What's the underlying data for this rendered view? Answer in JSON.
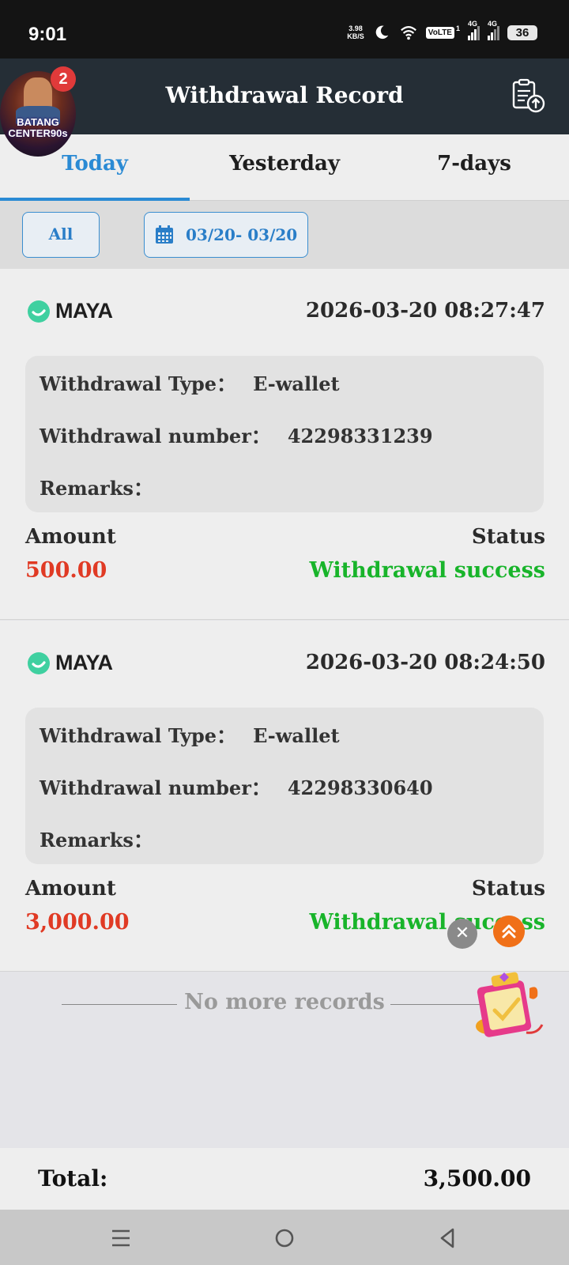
{
  "status_bar": {
    "time": "9:01",
    "net_speed_value": "3.98",
    "net_speed_unit": "KB/S",
    "volte": "VoLTE",
    "sim1_label": "4G",
    "sim2_label": "4G",
    "sim_sub": "1",
    "battery": "36"
  },
  "header": {
    "title": "Withdrawal Record",
    "avatar_text_line1": "BATANG",
    "avatar_text_line2": "CENTER90s",
    "notification_count": "2"
  },
  "tabs": [
    {
      "label": "Today",
      "active": true
    },
    {
      "label": "Yesterday",
      "active": false
    },
    {
      "label": "7-days",
      "active": false
    }
  ],
  "filters": {
    "all_label": "All",
    "date_range": "03/20- 03/20"
  },
  "labels": {
    "withdrawal_type": "Withdrawal Type：",
    "withdrawal_number": "Withdrawal number：",
    "remarks": "Remarks：",
    "amount": "Amount",
    "status": "Status"
  },
  "records": [
    {
      "method": "MAYA",
      "datetime": "2026-03-20 08:27:47",
      "type": "E-wallet",
      "number": "42298331239",
      "remarks": "",
      "amount": "500.00",
      "status": "Withdrawal success"
    },
    {
      "method": "MAYA",
      "datetime": "2026-03-20 08:24:50",
      "type": "E-wallet",
      "number": "42298330640",
      "remarks": "",
      "amount": "3,000.00",
      "status": "Withdrawal success"
    }
  ],
  "footer_note": "No more records",
  "total": {
    "label": "Total:",
    "value": "3,500.00"
  },
  "colors": {
    "accent": "#2a8ad4",
    "header_bg": "#252e36",
    "amount": "#e03a24",
    "success": "#18b42a",
    "maya": "#3fd0a0"
  },
  "icons": [
    "upload-record-icon",
    "calendar-icon",
    "maya-logo-icon",
    "close-icon",
    "scroll-top-icon",
    "gift-icon",
    "menu-icon",
    "home-icon",
    "back-icon"
  ]
}
